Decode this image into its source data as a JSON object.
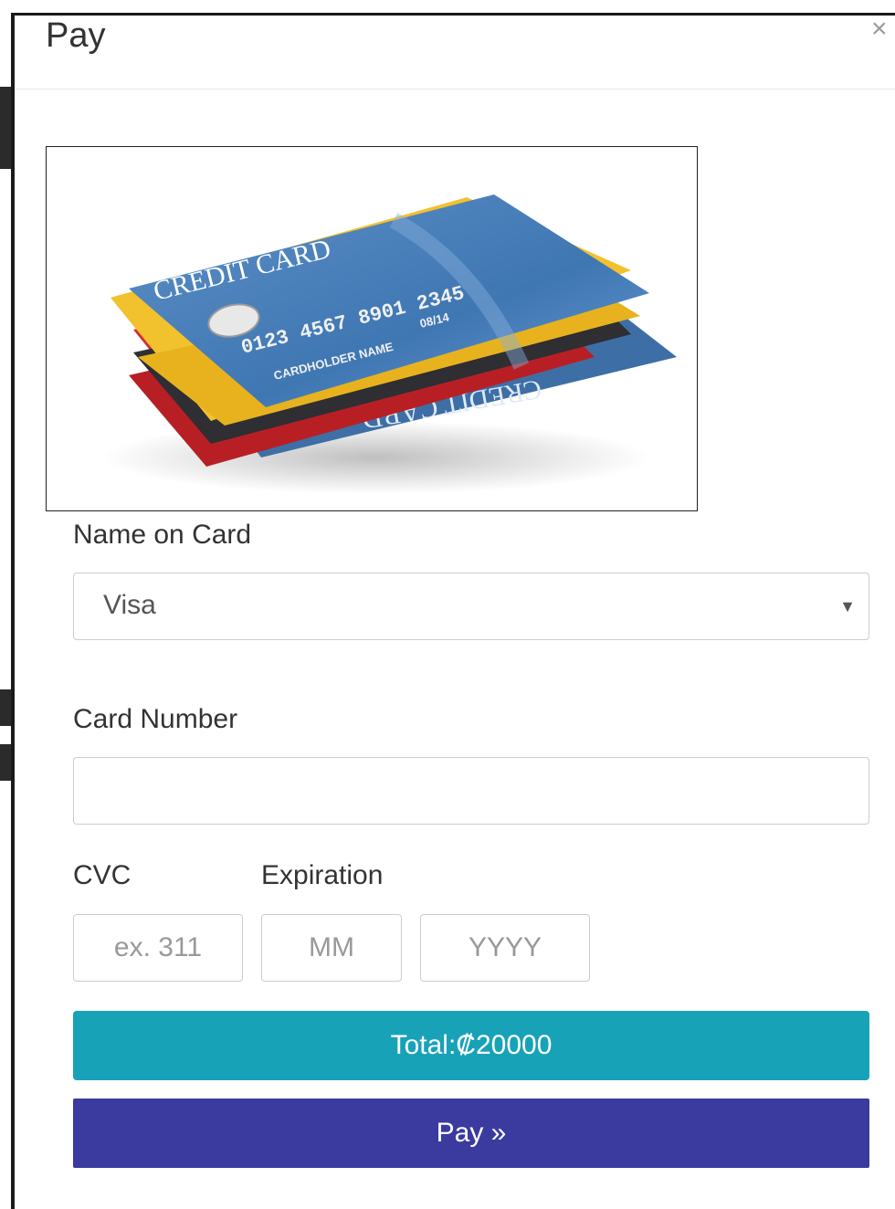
{
  "modal": {
    "title": "Pay",
    "close_symbol": "×",
    "image_name": "credit-card-stack-image"
  },
  "card_art": {
    "title": "CREDIT CARD",
    "number": "0123 4567 8901 2345",
    "expiry": "08/14",
    "holder": "CARDHOLDER NAME",
    "back_text": "CREDIT CARD"
  },
  "form": {
    "name_on_card": {
      "label": "Name on Card",
      "selected": "Visa",
      "caret": "▼"
    },
    "card_number": {
      "label": "Card Number",
      "value": "",
      "placeholder": ""
    },
    "cvc": {
      "label": "CVC",
      "placeholder": "ex. 311"
    },
    "expiration": {
      "label": "Expiration",
      "month_placeholder": "MM",
      "year_placeholder": "YYYY"
    }
  },
  "total": {
    "text": "Total:₡20000"
  },
  "pay_button": {
    "label": "Pay »"
  },
  "colors": {
    "total_bg": "#17a2b8",
    "pay_bg": "#3a3a9f",
    "card_blue": "#3f77b3",
    "card_red": "#c8262a",
    "card_yellow": "#f2c12e"
  }
}
